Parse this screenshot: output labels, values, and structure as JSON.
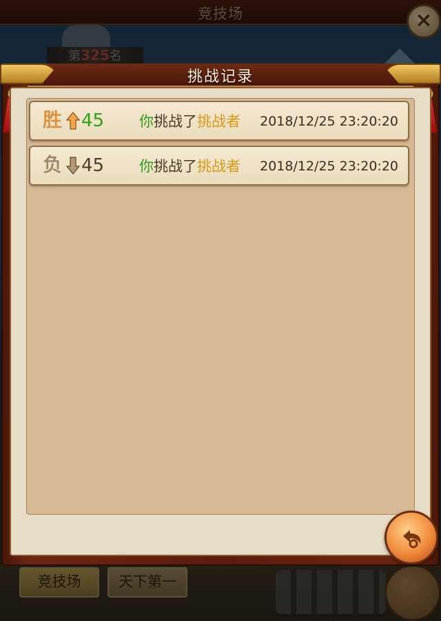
{
  "background": {
    "title": "竞技场",
    "rank": {
      "prefix": "第",
      "number": "325",
      "suffix": "名"
    },
    "tabs": [
      {
        "label": "竞技场",
        "active": true
      },
      {
        "label": "天下第一",
        "active": false
      }
    ],
    "close_icon": "close-icon"
  },
  "dialog": {
    "title": "挑战记录",
    "records": [
      {
        "result": "胜",
        "direction": "up",
        "points": "45",
        "desc_you": "你",
        "desc_verb": "挑战了",
        "desc_name": "挑战者",
        "time": "2018/12/25 23:20:20"
      },
      {
        "result": "负",
        "direction": "down",
        "points": "45",
        "desc_you": "你",
        "desc_verb": "挑战了",
        "desc_name": "挑战者",
        "time": "2018/12/25 23:20:20"
      }
    ],
    "back_icon": "back-arrow-icon"
  },
  "colors": {
    "win": "#2ea014",
    "result_win": "#e98d2d",
    "name": "#d99716",
    "you": "#2f9a14"
  }
}
